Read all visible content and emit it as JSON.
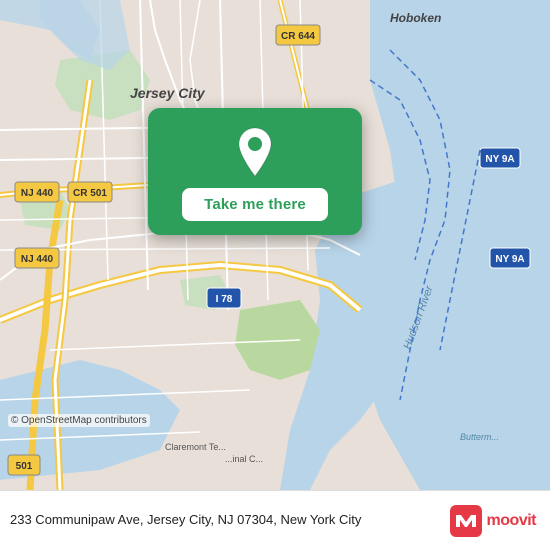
{
  "map": {
    "background_color": "#e8e0d8",
    "water_color": "#b5d0e8",
    "land_color": "#e8e0d8",
    "green_area_color": "#c8dfc0"
  },
  "popup": {
    "background_color": "#2e9e5b",
    "button_label": "Take me there",
    "pin_color": "white"
  },
  "bottom_bar": {
    "address": "233 Communipaw Ave, Jersey City, NJ 07304, New York City",
    "copyright": "© OpenStreetMap contributors",
    "brand_name": "moovit"
  }
}
